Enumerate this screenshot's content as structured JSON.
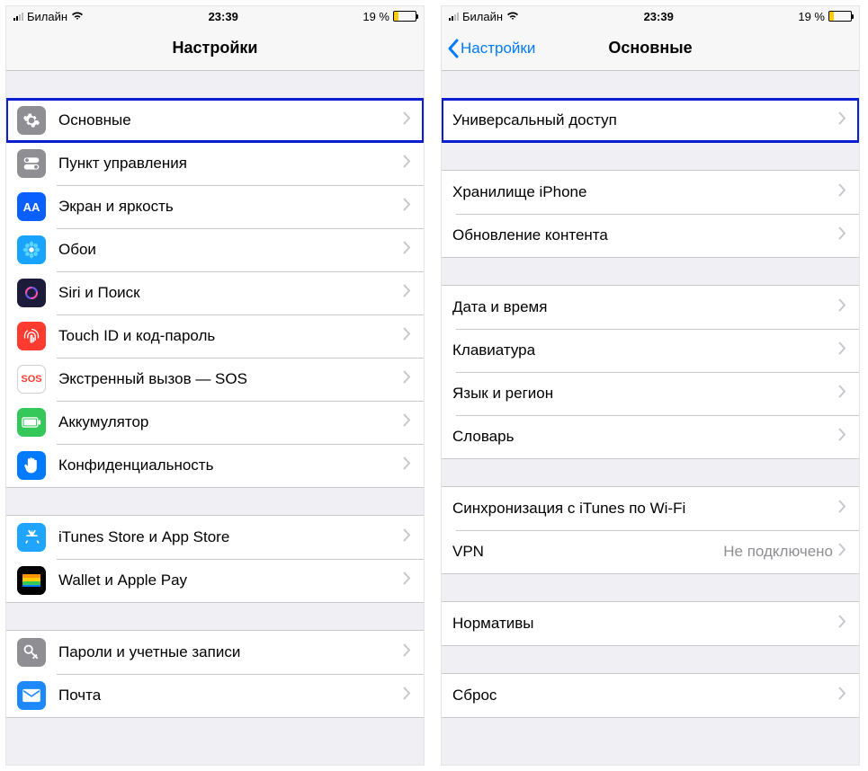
{
  "status": {
    "carrier": "Билайн",
    "time": "23:39",
    "battery_text": "19 %",
    "battery_level": 19,
    "wifi_icon": "wifi-icon",
    "signal_active": 2
  },
  "left": {
    "title": "Настройки",
    "groups": [
      {
        "items": [
          {
            "key": "general",
            "label": "Основные",
            "icon_bg": "#8e8e93",
            "icon_glyph": "gear",
            "highlight": true
          },
          {
            "key": "control",
            "label": "Пункт управления",
            "icon_bg": "#8e8e93",
            "icon_glyph": "toggle"
          },
          {
            "key": "display",
            "label": "Экран и яркость",
            "icon_bg": "#0a60ff",
            "icon_text": "AA"
          },
          {
            "key": "wallpaper",
            "label": "Обои",
            "icon_bg": "#18a3ff",
            "icon_glyph": "flower"
          },
          {
            "key": "siri",
            "label": "Siri и Поиск",
            "icon_bg": "#1c1c3a",
            "icon_glyph": "siri"
          },
          {
            "key": "touchid",
            "label": "Touch ID и код-пароль",
            "icon_bg": "#ff3b30",
            "icon_glyph": "finger"
          },
          {
            "key": "sos",
            "label": "Экстренный вызов — SOS",
            "icon_bg": "#ffffff",
            "icon_text": "SOS",
            "icon_fg": "#ff3b30",
            "icon_border": true
          },
          {
            "key": "battery",
            "label": "Аккумулятор",
            "icon_bg": "#34c759",
            "icon_glyph": "battery"
          },
          {
            "key": "privacy",
            "label": "Конфиденциальность",
            "icon_bg": "#007aff",
            "icon_glyph": "hand"
          }
        ]
      },
      {
        "items": [
          {
            "key": "itunes",
            "label": "iTunes Store и App Store",
            "icon_bg": "#1fa4ff",
            "icon_glyph": "appstore"
          },
          {
            "key": "wallet",
            "label": "Wallet и Apple Pay",
            "icon_bg": "#000000",
            "icon_glyph": "wallet"
          }
        ]
      },
      {
        "items": [
          {
            "key": "passwords",
            "label": "Пароли и учетные записи",
            "icon_bg": "#8e8e93",
            "icon_glyph": "key"
          },
          {
            "key": "mail",
            "label": "Почта",
            "icon_bg": "#1e88ff",
            "icon_glyph": "mail"
          }
        ]
      }
    ]
  },
  "right": {
    "back_label": "Настройки",
    "title": "Основные",
    "groups": [
      {
        "items": [
          {
            "key": "accessibility",
            "label": "Универсальный доступ",
            "highlight": true
          }
        ]
      },
      {
        "items": [
          {
            "key": "storage",
            "label": "Хранилище iPhone"
          },
          {
            "key": "refresh",
            "label": "Обновление контента"
          }
        ]
      },
      {
        "items": [
          {
            "key": "datetime",
            "label": "Дата и время"
          },
          {
            "key": "keyboard",
            "label": "Клавиатура"
          },
          {
            "key": "langregion",
            "label": "Язык и регион"
          },
          {
            "key": "dictionary",
            "label": "Словарь"
          }
        ]
      },
      {
        "items": [
          {
            "key": "itunessync",
            "label": "Синхронизация с iTunes по Wi-Fi"
          },
          {
            "key": "vpn",
            "label": "VPN",
            "detail": "Не подключено"
          }
        ]
      },
      {
        "items": [
          {
            "key": "regulatory",
            "label": "Нормативы"
          }
        ]
      },
      {
        "items": [
          {
            "key": "reset",
            "label": "Сброс"
          }
        ]
      }
    ]
  }
}
